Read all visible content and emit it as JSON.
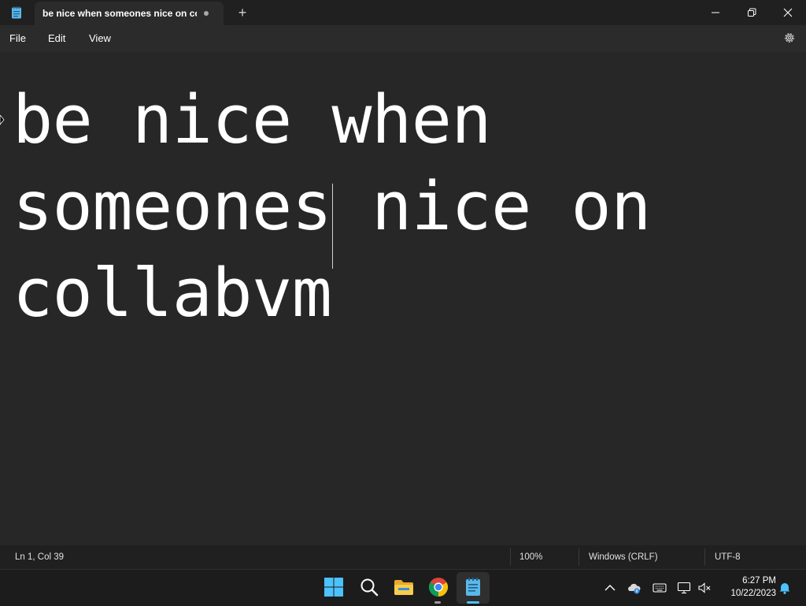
{
  "window": {
    "tab_title": "be nice when someones nice on co",
    "new_tab_symbol": "+"
  },
  "menu": {
    "file": "File",
    "edit": "Edit",
    "view": "View"
  },
  "editor": {
    "lines": [
      "be nice when",
      "someones nice on",
      "collabvm"
    ]
  },
  "statusbar": {
    "position": "Ln 1, Col 39",
    "zoom": "100%",
    "line_ending": "Windows (CRLF)",
    "encoding": "UTF-8"
  },
  "taskbar": {
    "apps": [
      "start-icon",
      "search-icon",
      "file-explorer-icon",
      "chrome-icon",
      "notepad-icon"
    ]
  },
  "tray": {
    "time": "6:27 PM",
    "date": "10/22/2023"
  },
  "colors": {
    "accent": "#4cc2ff",
    "background": "#272727"
  }
}
